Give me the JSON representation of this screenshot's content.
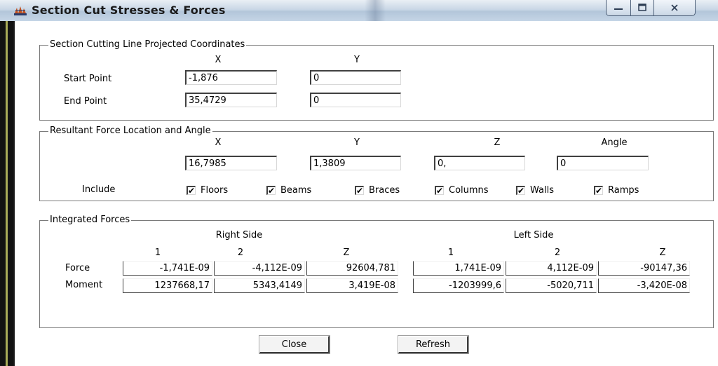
{
  "window": {
    "title": "Section Cut Stresses & Forces"
  },
  "section_cutting_line": {
    "group_title": "Section Cutting Line Projected Coordinates",
    "col_x": "X",
    "col_y": "Y",
    "start_label": "Start Point",
    "start_x": "-1,876",
    "start_y": "0",
    "end_label": "End Point",
    "end_x": "35,4729",
    "end_y": "0"
  },
  "resultant": {
    "group_title": "Resultant Force Location and Angle",
    "col_x": "X",
    "col_y": "Y",
    "col_z": "Z",
    "col_angle": "Angle",
    "x": "16,7985",
    "y": "1,3809",
    "z": "0,",
    "angle": "0",
    "include_label": "Include",
    "checkboxes": [
      {
        "label": "Floors",
        "checked": true
      },
      {
        "label": "Beams",
        "checked": true
      },
      {
        "label": "Braces",
        "checked": true
      },
      {
        "label": "Columns",
        "checked": true
      },
      {
        "label": "Walls",
        "checked": true
      },
      {
        "label": "Ramps",
        "checked": true
      }
    ]
  },
  "integrated": {
    "group_title": "Integrated Forces",
    "right_side_label": "Right Side",
    "left_side_label": "Left Side",
    "col_1": "1",
    "col_2": "2",
    "col_z": "Z",
    "force_label": "Force",
    "moment_label": "Moment",
    "force_right": [
      "-1,741E-09",
      "-4,112E-09",
      "92604,781"
    ],
    "force_left": [
      "1,741E-09",
      "4,112E-09",
      "-90147,36"
    ],
    "moment_right": [
      "1237668,17",
      "5343,4149",
      "3,419E-08"
    ],
    "moment_left": [
      "-1203999,6",
      "-5020,711",
      "-3,420E-08"
    ]
  },
  "buttons": {
    "close": "Close",
    "refresh": "Refresh"
  },
  "icons": {
    "check": "✔",
    "minimize": "minimize-icon",
    "maximize": "maximize-icon",
    "close": "close-icon"
  }
}
